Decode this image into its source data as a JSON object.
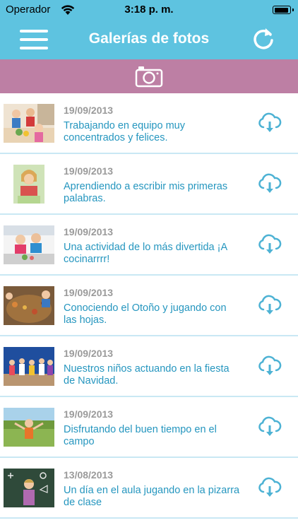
{
  "status": {
    "carrier": "Operador",
    "time": "3:18 p. m.",
    "battery_level": 0.95
  },
  "header": {
    "title": "Galerías de fotos",
    "menu_icon": "hamburger-menu-icon",
    "refresh_icon": "refresh-icon"
  },
  "toolbar": {
    "camera_icon": "camera-icon"
  },
  "colors": {
    "header": "#5ec3e0",
    "toolbar": "#bd7fa4",
    "caption": "#2596bf",
    "date": "#9a9a9a"
  },
  "items": [
    {
      "date": "19/09/2013",
      "caption": "Trabajando en equipo muy concentrados y felices."
    },
    {
      "date": "19/09/2013",
      "caption": "Aprendiendo a escribir mis primeras palabras."
    },
    {
      "date": "19/09/2013",
      "caption": "Una actividad de lo más divertida ¡A cocinarrrr!"
    },
    {
      "date": "19/09/2013",
      "caption": "Conociendo el Otoño y jugando con las hojas."
    },
    {
      "date": "19/09/2013",
      "caption": "Nuestros niños actuando en la fiesta de Navidad."
    },
    {
      "date": "19/09/2013",
      "caption": "Disfrutando del buen tiempo en el campo"
    },
    {
      "date": "13/08/2013",
      "caption": "Un día en el aula jugando en la pizarra de clase"
    }
  ]
}
